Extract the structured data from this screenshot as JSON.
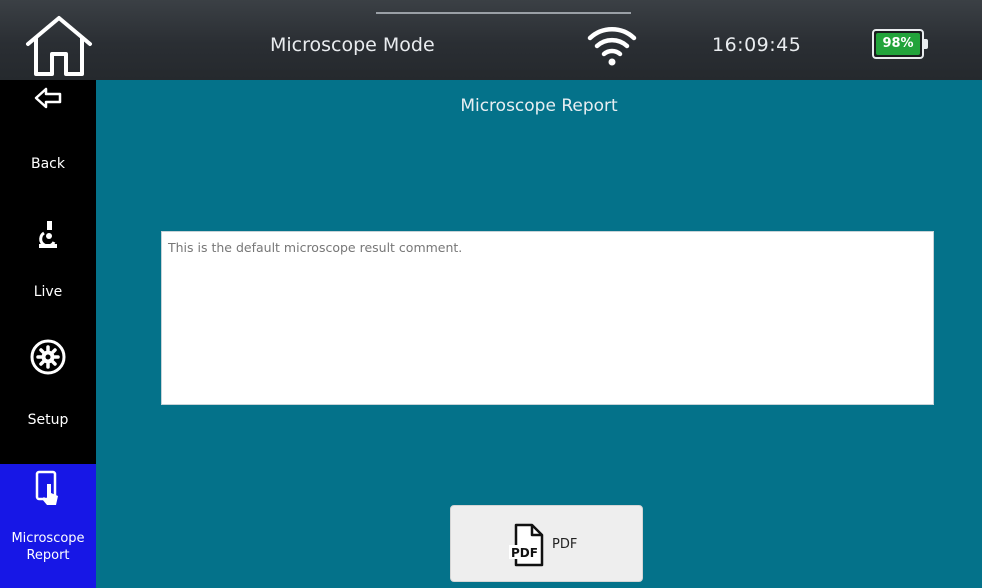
{
  "header": {
    "title": "Microscope Mode",
    "time": "16:09:45",
    "battery": "98%"
  },
  "sidebar": {
    "items": [
      {
        "label": "Back",
        "icon": "back-arrow-icon"
      },
      {
        "label": "Live",
        "icon": "microscope-icon"
      },
      {
        "label": "Setup",
        "icon": "gear-icon"
      },
      {
        "label_line1": "Microscope",
        "label_line2": "Report",
        "icon": "tablet-touch-icon",
        "active": true
      }
    ]
  },
  "main": {
    "title": "Microscope Report",
    "comment": "This is the default microscope result comment.",
    "pdf_button": {
      "icon_text": "PDF",
      "label": "PDF"
    }
  },
  "colors": {
    "topbar": "#2a2e33",
    "sidebar": "#000000",
    "active_item": "#1717e6",
    "main_bg": "#04728a",
    "battery": "#22a33b"
  }
}
